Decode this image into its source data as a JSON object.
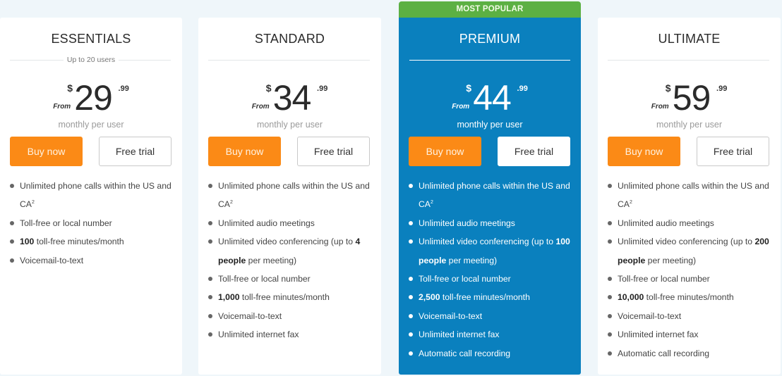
{
  "colors": {
    "background": "#eff6fa",
    "featured": "#0a80be",
    "badge": "#5cb043",
    "buy_button": "#fb8a16"
  },
  "plans": [
    {
      "name": "ESSENTIALS",
      "subtitle": "Up to 20 users",
      "from": "From",
      "currency": "$",
      "amount": "29",
      "cents": ".99",
      "period": "monthly per user",
      "buy_label": "Buy now",
      "trial_label": "Free trial",
      "features": [
        {
          "icon": "bullet-icon",
          "bold": "",
          "text": "Unlimited phone calls within the US and CA",
          "sup": "2"
        },
        {
          "icon": "bullet-icon",
          "bold": "",
          "text": "Toll-free or local number",
          "sup": ""
        },
        {
          "icon": "bullet-icon",
          "bold": "100",
          "text": " toll-free minutes/month",
          "sup": ""
        },
        {
          "icon": "bullet-icon",
          "bold": "",
          "text": "Voicemail-to-text",
          "sup": ""
        }
      ]
    },
    {
      "name": "STANDARD",
      "subtitle": "",
      "from": "From",
      "currency": "$",
      "amount": "34",
      "cents": ".99",
      "period": "monthly per user",
      "buy_label": "Buy now",
      "trial_label": "Free trial",
      "features": [
        {
          "icon": "bullet-icon",
          "bold": "",
          "text": "Unlimited phone calls within the US and CA",
          "sup": "2"
        },
        {
          "icon": "bullet-icon",
          "bold": "",
          "text": "Unlimited audio meetings",
          "sup": ""
        },
        {
          "icon": "bullet-icon",
          "prefix": "Unlimited video conferencing (up to ",
          "bold": "4 people",
          "text": " per meeting)",
          "sup": ""
        },
        {
          "icon": "bullet-icon",
          "bold": "",
          "text": "Toll-free or local number",
          "sup": ""
        },
        {
          "icon": "bullet-icon",
          "bold": "1,000",
          "text": " toll-free minutes/month",
          "sup": ""
        },
        {
          "icon": "bullet-icon",
          "bold": "",
          "text": "Voicemail-to-text",
          "sup": ""
        },
        {
          "icon": "bullet-icon",
          "bold": "",
          "text": "Unlimited internet fax",
          "sup": ""
        }
      ]
    },
    {
      "name": "PREMIUM",
      "badge": "MOST POPULAR",
      "subtitle": "",
      "from": "From",
      "currency": "$",
      "amount": "44",
      "cents": ".99",
      "period": "monthly per user",
      "buy_label": "Buy now",
      "trial_label": "Free trial",
      "features": [
        {
          "icon": "bullet-icon",
          "bold": "",
          "text": "Unlimited phone calls within the US and CA",
          "sup": "2"
        },
        {
          "icon": "bullet-icon",
          "bold": "",
          "text": "Unlimited audio meetings",
          "sup": ""
        },
        {
          "icon": "bullet-icon",
          "prefix": "Unlimited video conferencing (up to ",
          "bold": "100 people",
          "text": " per meeting)",
          "sup": ""
        },
        {
          "icon": "bullet-icon",
          "bold": "",
          "text": "Toll-free or local number",
          "sup": ""
        },
        {
          "icon": "bullet-icon",
          "bold": "2,500",
          "text": " toll-free minutes/month",
          "sup": ""
        },
        {
          "icon": "bullet-icon",
          "bold": "",
          "text": "Voicemail-to-text",
          "sup": ""
        },
        {
          "icon": "bullet-icon",
          "bold": "",
          "text": "Unlimited internet fax",
          "sup": ""
        },
        {
          "icon": "bullet-icon",
          "bold": "",
          "text": "Automatic call recording",
          "sup": ""
        }
      ]
    },
    {
      "name": "ULTIMATE",
      "subtitle": "",
      "from": "From",
      "currency": "$",
      "amount": "59",
      "cents": ".99",
      "period": "monthly per user",
      "buy_label": "Buy now",
      "trial_label": "Free trial",
      "features": [
        {
          "icon": "bullet-icon",
          "bold": "",
          "text": "Unlimited phone calls within the US and CA",
          "sup": "2"
        },
        {
          "icon": "bullet-icon",
          "bold": "",
          "text": "Unlimited audio meetings",
          "sup": ""
        },
        {
          "icon": "bullet-icon",
          "prefix": "Unlimited video conferencing (up to ",
          "bold": "200 people",
          "text": " per meeting)",
          "sup": ""
        },
        {
          "icon": "bullet-icon",
          "bold": "",
          "text": "Toll-free or local number",
          "sup": ""
        },
        {
          "icon": "bullet-icon",
          "bold": "10,000",
          "text": " toll-free minutes/month",
          "sup": ""
        },
        {
          "icon": "bullet-icon",
          "bold": "",
          "text": "Voicemail-to-text",
          "sup": ""
        },
        {
          "icon": "bullet-icon",
          "bold": "",
          "text": "Unlimited internet fax",
          "sup": ""
        },
        {
          "icon": "bullet-icon",
          "bold": "",
          "text": "Automatic call recording",
          "sup": ""
        }
      ]
    }
  ]
}
